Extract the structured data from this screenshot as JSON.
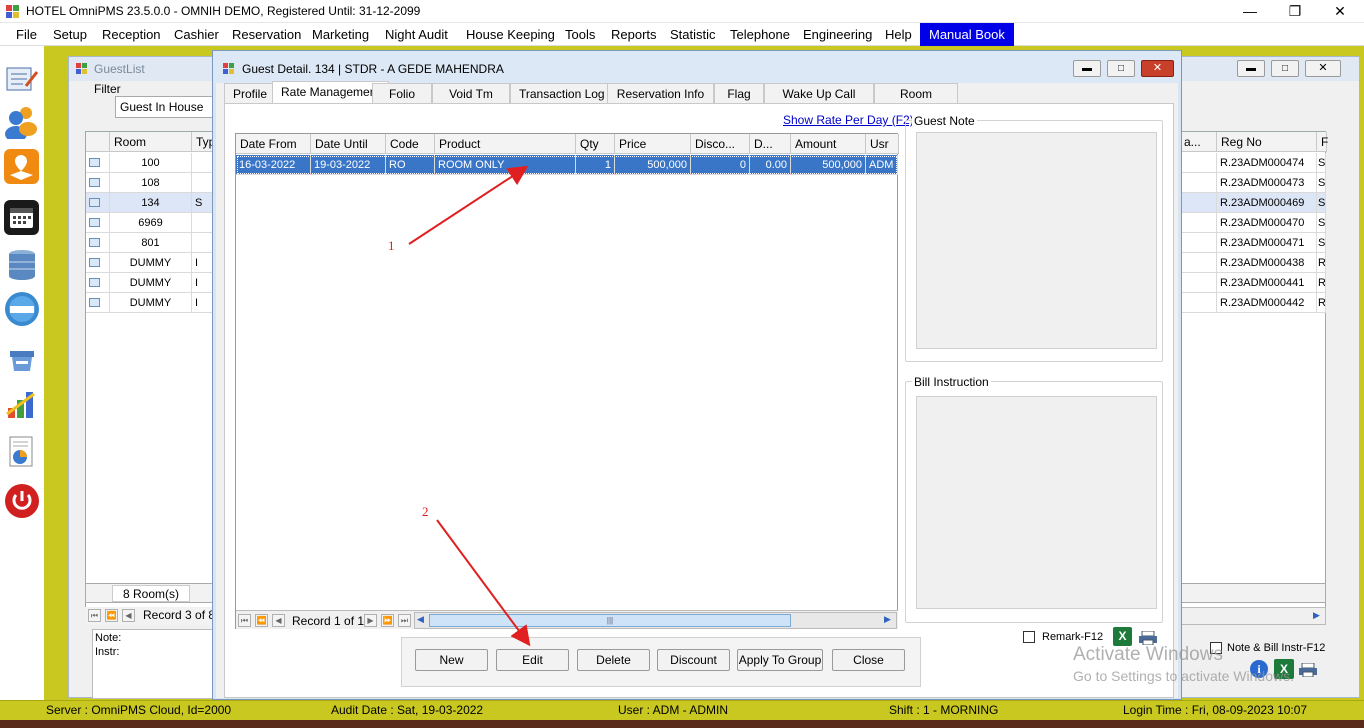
{
  "app": {
    "title": "HOTEL OmniPMS 23.5.0.0 - OMNIH DEMO, Registered Until: 31-12-2099"
  },
  "menu": [
    "File",
    "Setup",
    "Reception",
    "Cashier",
    "Reservation",
    "Marketing",
    "Night Audit",
    "House Keeping",
    "Tools",
    "Reports",
    "Statistic",
    "Telephone",
    "Engineering",
    "Help",
    "Manual Book"
  ],
  "guestlist": {
    "title": "GuestList",
    "filter_label": "Filter",
    "filter_value": "Guest In House",
    "col_room": "Room",
    "col_type": "Typ",
    "col_regno": "Reg No",
    "col_hidden": "a...",
    "col_last": "F",
    "rows": [
      {
        "room": "100",
        "type": "",
        "regno": "R.23ADM000474",
        "last": "S",
        "selected": false
      },
      {
        "room": "108",
        "type": "",
        "regno": "R.23ADM000473",
        "last": "S",
        "selected": false
      },
      {
        "room": "134",
        "type": "S",
        "regno": "R.23ADM000469",
        "last": "S",
        "selected": true
      },
      {
        "room": "6969",
        "type": "",
        "regno": "R.23ADM000470",
        "last": "S",
        "selected": false
      },
      {
        "room": "801",
        "type": "",
        "regno": "R.23ADM000471",
        "last": "S",
        "selected": false
      },
      {
        "room": "DUMMY",
        "type": "I",
        "regno": "R.23ADM000438",
        "last": "R",
        "selected": false
      },
      {
        "room": "DUMMY",
        "type": "I",
        "regno": "R.23ADM000441",
        "last": "R",
        "selected": false
      },
      {
        "room": "DUMMY",
        "type": "I",
        "regno": "R.23ADM000442",
        "last": "R",
        "selected": false
      }
    ],
    "room_count": "8 Room(s)",
    "record_nav": "Record 3 of 8",
    "note_label": "Note:",
    "instr_label": "Instr:",
    "note_bill_check": "Note & Bill Instr-F12"
  },
  "detail": {
    "title": "Guest Detail. 134 | STDR - A GEDE MAHENDRA",
    "tabs": [
      "Profile",
      "Rate Management",
      "Folio",
      "Void Tm",
      "Transaction Log",
      "Reservation Info",
      "Flag",
      "Wake Up Call",
      "Room Sharer"
    ],
    "active_tab": "Rate Management",
    "show_rate_link": "Show Rate Per Day (F2)",
    "columns": [
      "Date From",
      "Date Until",
      "Code",
      "Product",
      "Qty",
      "Price",
      "Disco...",
      "D...",
      "Amount",
      "Usr"
    ],
    "rate_rows": [
      {
        "date_from": "16-03-2022",
        "date_until": "19-03-2022",
        "code": "RO",
        "product": "ROOM ONLY",
        "qty": "1",
        "price": "500,000",
        "discount": "0",
        "d": "0.00",
        "amount": "500,000",
        "usr": "ADM"
      }
    ],
    "record_nav": "Record 1 of 1",
    "guest_note_label": "Guest Note",
    "bill_instruction_label": "Bill Instruction",
    "remark_label": "Remark-F12",
    "buttons": [
      "New",
      "Edit",
      "Delete",
      "Discount",
      "Apply To Group",
      "Close"
    ]
  },
  "annotations": {
    "arrow1": "1",
    "arrow2": "2"
  },
  "watermark": {
    "line1": "Activate Windows",
    "line2": "Go to Settings to activate Windows."
  },
  "status": {
    "server": "Server : OmniPMS Cloud, Id=2000",
    "audit": "Audit Date : Sat, 19-03-2022",
    "user": "User : ADM - ADMIN",
    "shift": "Shift : 1 - MORNING",
    "login": "Login Time : Fri, 08-09-2023 10:07"
  },
  "colors": {
    "accent_yellow": "#c8c820",
    "menu_highlight": "#0000e8",
    "selection": "#3a76c8",
    "arrow": "#e02020"
  }
}
